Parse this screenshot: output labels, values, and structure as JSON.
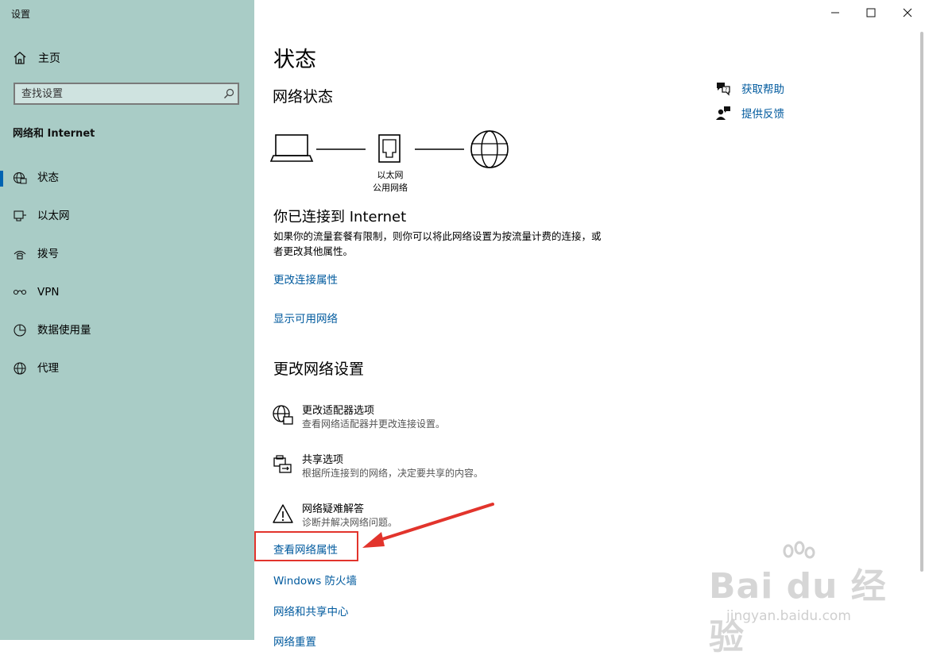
{
  "window": {
    "title": "设置",
    "controls": [
      "minimize-icon",
      "maximize-icon",
      "close-icon"
    ]
  },
  "sidebar": {
    "home_label": "主页",
    "search_placeholder": "查找设置",
    "section_title": "网络和 Internet",
    "items": [
      {
        "label": "状态",
        "icon": "status-globe-icon",
        "active": true
      },
      {
        "label": "以太网",
        "icon": "ethernet-icon",
        "active": false
      },
      {
        "label": "拨号",
        "icon": "dialup-icon",
        "active": false
      },
      {
        "label": "VPN",
        "icon": "vpn-icon",
        "active": false
      },
      {
        "label": "数据使用量",
        "icon": "data-usage-icon",
        "active": false
      },
      {
        "label": "代理",
        "icon": "proxy-globe-icon",
        "active": false
      }
    ]
  },
  "main": {
    "page_title": "状态",
    "network_status_heading": "网络状态",
    "diagram": {
      "adapter_name": "以太网",
      "network_type": "公用网络"
    },
    "connected_heading": "你已连接到 Internet",
    "connected_description": "如果你的流量套餐有限制，则你可以将此网络设置为按流量计费的连接，或者更改其他属性。",
    "links_top": [
      "更改连接属性",
      "显示可用网络"
    ],
    "change_settings_heading": "更改网络设置",
    "options": [
      {
        "title": "更改适配器选项",
        "description": "查看网络适配器并更改连接设置。",
        "icon": "adapter-globe-icon"
      },
      {
        "title": "共享选项",
        "description": "根据所连接到的网络，决定要共享的内容。",
        "icon": "sharing-icon"
      },
      {
        "title": "网络疑难解答",
        "description": "诊断并解决网络问题。",
        "icon": "warning-icon"
      }
    ],
    "links_bottom": [
      "查看网络属性",
      "Windows 防火墙",
      "网络和共享中心",
      "网络重置"
    ]
  },
  "aside": {
    "help_label": "获取帮助",
    "feedback_label": "提供反馈"
  },
  "annotation": {
    "highlight_color": "#e2342c"
  },
  "watermark": {
    "main": "Bai du 经验",
    "sub": "jingyan.baidu.com"
  },
  "colors": {
    "sidebar_bg": "#a9ccc6",
    "accent": "#0063b1",
    "link": "#005a9e"
  }
}
